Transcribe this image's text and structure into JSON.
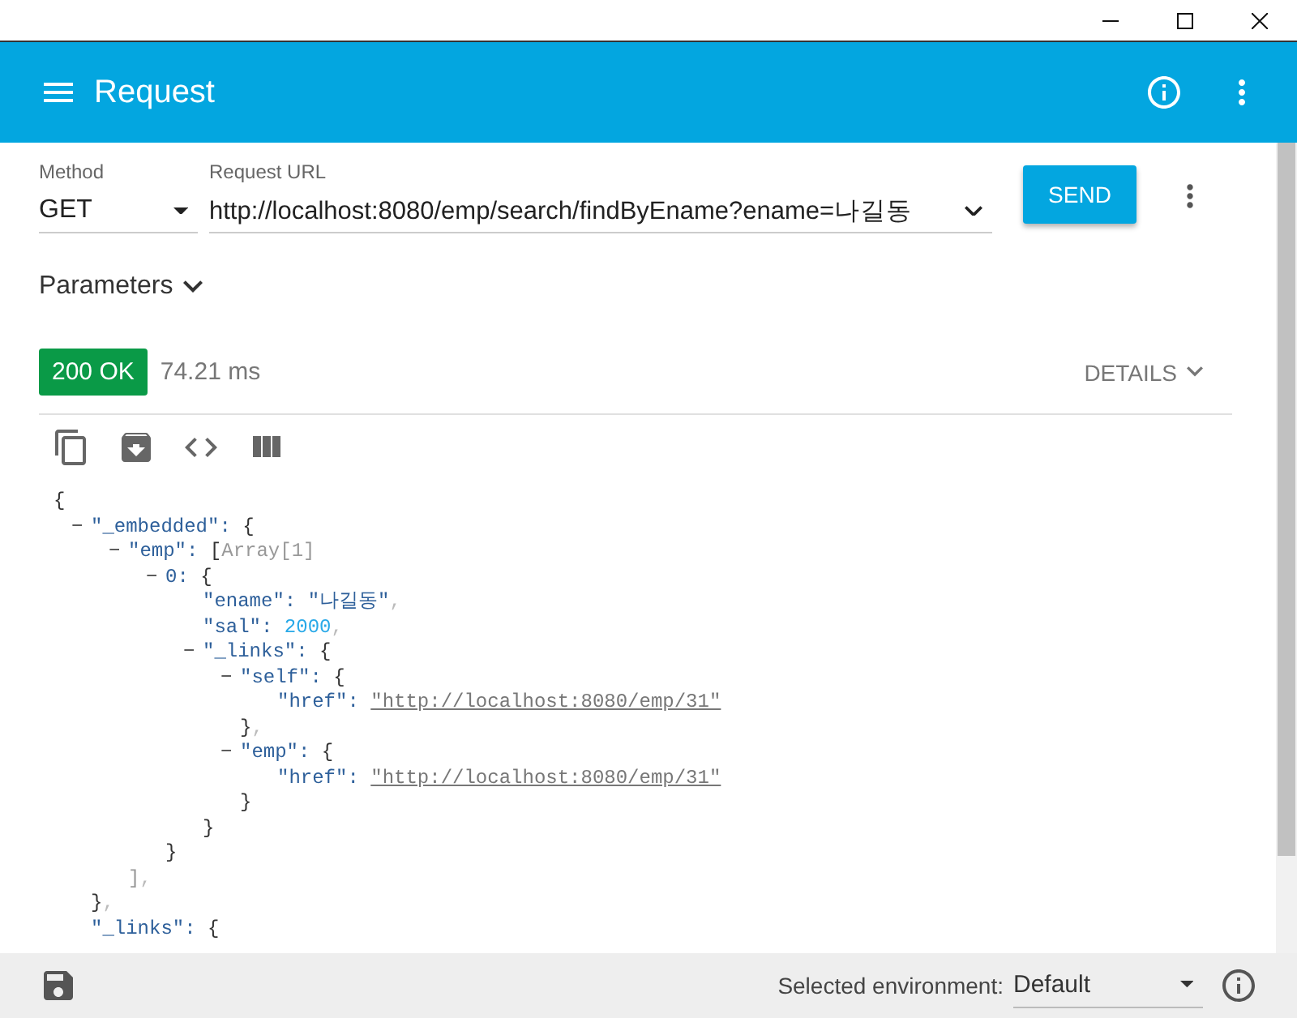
{
  "app_bar": {
    "title": "Request"
  },
  "request": {
    "method_label": "Method",
    "method": "GET",
    "url_label": "Request URL",
    "url": "http://localhost:8080/emp/search/findByEname?ename=나길동",
    "send_label": "SEND"
  },
  "parameters": {
    "label": "Parameters",
    "expanded": false
  },
  "response": {
    "status": "200 OK",
    "time": "74.21 ms",
    "details_label": "DETAILS",
    "body": {
      "open": "{",
      "children": [
        {
          "toggle": "−",
          "key": "\"_embedded\":",
          "open": "{",
          "children": [
            {
              "toggle": "−",
              "key": "\"emp\":",
              "open": "[",
              "note": "Array[1]",
              "children": [
                {
                  "toggle": "−",
                  "key": "0:",
                  "open": "{",
                  "children": [
                    {
                      "key": "\"ename\":",
                      "value": "\"나길동\"",
                      "kind": "string",
                      "comma": ","
                    },
                    {
                      "key": "\"sal\":",
                      "value": "2000",
                      "kind": "number",
                      "comma": ","
                    },
                    {
                      "toggle": "−",
                      "key": "\"_links\":",
                      "open": "{",
                      "children": [
                        {
                          "toggle": "−",
                          "key": "\"self\":",
                          "open": "{",
                          "children": [
                            {
                              "key": "\"href\":",
                              "value": "\"http://localhost:8080/emp/31\"",
                              "kind": "link"
                            }
                          ],
                          "close": "}",
                          "comma": ","
                        },
                        {
                          "toggle": "−",
                          "key": "\"emp\":",
                          "open": "{",
                          "children": [
                            {
                              "key": "\"href\":",
                              "value": "\"http://localhost:8080/emp/31\"",
                              "kind": "link"
                            }
                          ],
                          "close": "}"
                        }
                      ],
                      "close": "}"
                    }
                  ],
                  "close": "}"
                }
              ],
              "close": "]",
              "comma": ","
            }
          ],
          "close": "}",
          "comma": ","
        },
        {
          "key": "\"_links\":",
          "open": "{"
        }
      ]
    }
  },
  "footer": {
    "environment_label": "Selected environment:",
    "environment": "Default"
  }
}
